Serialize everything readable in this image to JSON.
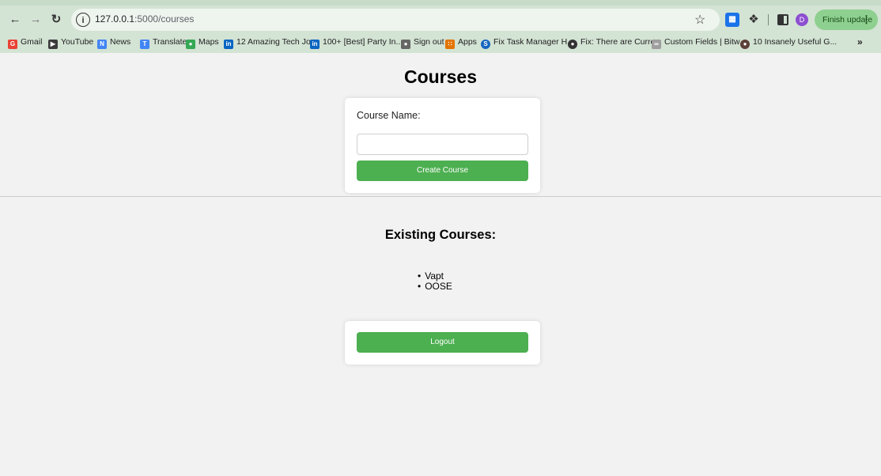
{
  "browser": {
    "url_host": "127.0.0.1",
    "url_path": ":5000/courses",
    "finish_update_label": "Finish update",
    "avatar_letter": "D",
    "bookmarks": [
      {
        "label": "Gmail",
        "icon": "G",
        "color": "#ea4335"
      },
      {
        "label": "YouTube",
        "icon": "▶",
        "color": "#3c3c3c"
      },
      {
        "label": "News",
        "icon": "N",
        "color": "#4285f4"
      },
      {
        "label": "Translate",
        "icon": "T",
        "color": "#4285f4"
      },
      {
        "label": "Maps",
        "icon": "●",
        "color": "#34a853"
      },
      {
        "label": "12 Amazing Tech Jo...",
        "icon": "in",
        "color": "#0a66c2"
      },
      {
        "label": "100+ [Best] Party In...",
        "icon": "in",
        "color": "#0a66c2"
      },
      {
        "label": "Sign out",
        "icon": "●",
        "color": "#666666"
      },
      {
        "label": "Apps",
        "icon": "∷",
        "color": "#e37400"
      },
      {
        "label": "Fix Task Manager H...",
        "icon": "S",
        "color": "#1565c0"
      },
      {
        "label": "Fix: There are Curre...",
        "icon": "●",
        "color": "#333333"
      },
      {
        "label": "Custom Fields | Bitw...",
        "icon": "∞",
        "color": "#9e9e9e"
      },
      {
        "label": "10 Insanely Useful G...",
        "icon": "●",
        "color": "#5d4037"
      }
    ]
  },
  "page": {
    "title": "Courses",
    "form": {
      "label": "Course Name:",
      "input_value": "",
      "create_button": "Create Course"
    },
    "existing_title": "Existing Courses:",
    "courses": [
      "Vapt",
      "OOSE"
    ],
    "logout_button": "Logout"
  },
  "colors": {
    "accent_green": "#4caf50",
    "chrome_green": "#d3e3d4"
  }
}
